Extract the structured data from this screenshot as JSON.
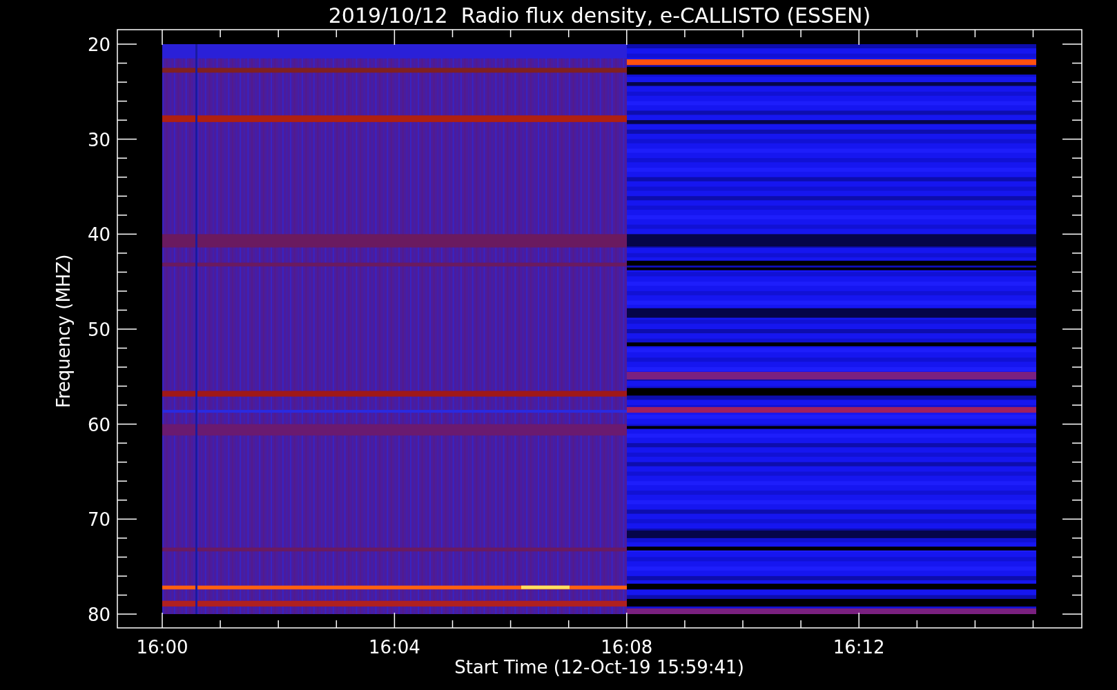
{
  "chart": {
    "title": "2019/10/12  Radio flux density, e-CALLISTO (ESSEN)",
    "ylabel": "Frequency (MHZ)",
    "xlabel": "Start Time (12-Oct-19 15:59:41)",
    "yticks": [
      "20",
      "30",
      "40",
      "50",
      "60",
      "70",
      "80"
    ],
    "xticks": [
      "16:00",
      "16:04",
      "16:08",
      "16:12"
    ]
  }
}
